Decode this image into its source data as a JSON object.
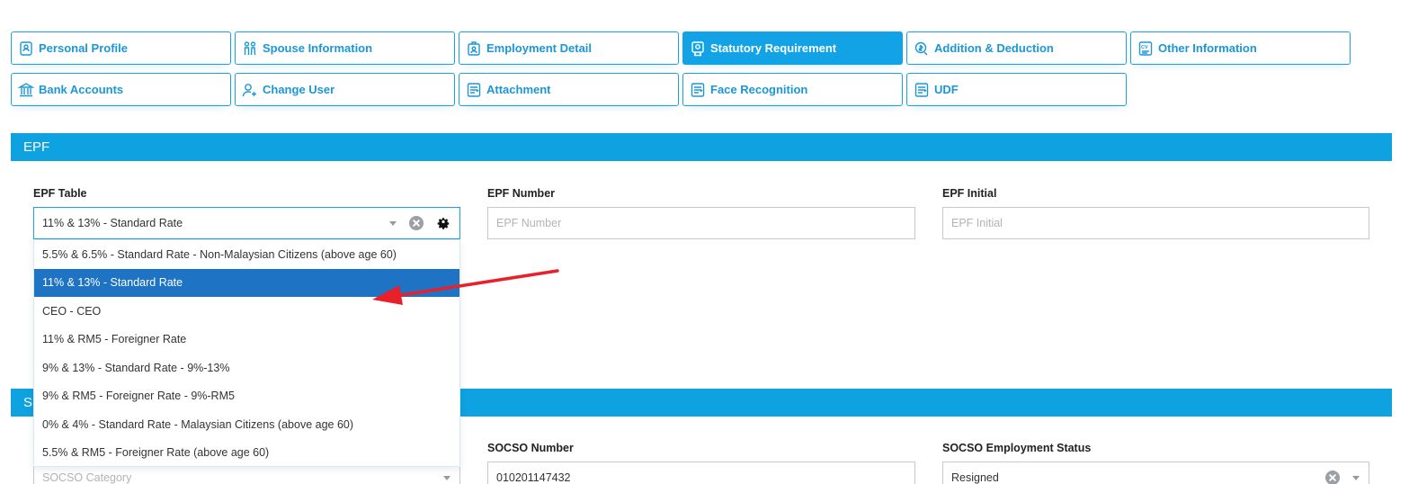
{
  "tabs": [
    {
      "label": "Personal Profile",
      "icon": "profile-badge-icon",
      "active": false
    },
    {
      "label": "Spouse Information",
      "icon": "couple-icon",
      "active": false
    },
    {
      "label": "Employment Detail",
      "icon": "briefcase-icon",
      "active": false
    },
    {
      "label": "Statutory Requirement",
      "icon": "certificate-icon",
      "active": true
    },
    {
      "label": "Addition & Deduction",
      "icon": "money-icon",
      "active": false
    },
    {
      "label": "Other Information",
      "icon": "cv-icon",
      "active": false
    },
    {
      "label": "Bank Accounts",
      "icon": "bank-icon",
      "active": false
    },
    {
      "label": "Change User",
      "icon": "user-plus-icon",
      "active": false
    },
    {
      "label": "Attachment",
      "icon": "document-icon",
      "active": false
    },
    {
      "label": "Face Recognition",
      "icon": "document-icon",
      "active": false
    },
    {
      "label": "UDF",
      "icon": "document-icon",
      "active": false
    }
  ],
  "epf": {
    "section_title": "EPF",
    "table_label": "EPF Table",
    "table_value": "11% & 13% - Standard Rate",
    "number_label": "EPF Number",
    "number_placeholder": "EPF Number",
    "initial_label": "EPF Initial",
    "initial_placeholder": "EPF Initial",
    "options": [
      "5.5% & 6.5% - Standard Rate - Non-Malaysian Citizens (above age 60)",
      "11% & 13% - Standard Rate",
      "CEO - CEO",
      "11% & RM5 - Foreigner Rate",
      "9% & 13% - Standard Rate - 9%-13%",
      "9% & RM5 - Foreigner Rate - 9%-RM5",
      "0% & 4% - Standard Rate - Malaysian Citizens (above age 60)",
      "5.5% & RM5 - Foreigner Rate (above age 60)"
    ],
    "selected_option": "11% & 13% - Standard Rate"
  },
  "socso": {
    "section_title_visible": "S",
    "category_placeholder": "SOCSO Category",
    "number_label": "SOCSO Number",
    "number_value": "010201147432",
    "status_label": "SOCSO Employment Status",
    "status_value": "Resigned"
  },
  "colors": {
    "accent": "#0ea2e0",
    "tab_border": "#1ba1e2",
    "selected_option": "#1e73c4",
    "annotation_arrow": "#e8202a"
  }
}
